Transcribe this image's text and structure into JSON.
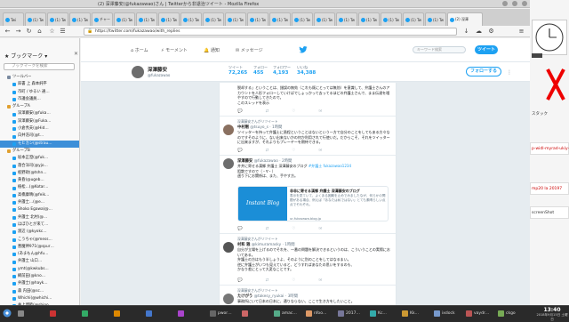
{
  "window": {
    "title": "(2) 深澤藤安(@fukazawao)さん | Twitterから非退治ツイート - Mozilla Firefox",
    "tabs": [
      {
        "label": "Twi"
      },
      {
        "label": "(1) Tw"
      },
      {
        "label": "(1) Tw"
      },
      {
        "label": "(1) Tw"
      },
      {
        "label": "チャー"
      },
      {
        "label": "(1) Tw"
      },
      {
        "label": "(1) Tw"
      },
      {
        "label": "(1) Tw"
      },
      {
        "label": "(1) Tw"
      },
      {
        "label": "(1) Tw"
      },
      {
        "label": "(1) Tw"
      },
      {
        "label": "(1) Tw"
      },
      {
        "label": "(1) Tw"
      },
      {
        "label": "(1) Tw"
      },
      {
        "label": "(1) Tw"
      },
      {
        "label": "(1) Tw"
      },
      {
        "label": "(1) Tw"
      },
      {
        "label": "(1) Tw"
      },
      {
        "label": "(1) Tw"
      },
      {
        "label": "(1) Tw"
      },
      {
        "label": "(2) 深澤"
      }
    ],
    "url": "https://twitter.com/fukazawao/with_replies"
  },
  "sidebar": {
    "title": "ブックマーク",
    "search_placeholder": "ブックマークを検索",
    "items": [
      {
        "label": "ツールバー",
        "color": "#7a8aa0",
        "sel": false
      },
      {
        "label": "辞書 上 森本純平",
        "color": "#1da1f2",
        "sel": false
      },
      {
        "label": "市町 / ゆるい 通…",
        "color": "#1da1f2",
        "sel": false
      },
      {
        "label": "市議会議員…",
        "color": "#1da1f2",
        "sel": false
      },
      {
        "label": "グループA",
        "color": "#e0a030",
        "sel": false
      },
      {
        "label": "深澤藤安(@fuka…",
        "color": "#1da1f2",
        "sel": false
      },
      {
        "label": "深澤藤安(@Fuka…",
        "color": "#1da1f2",
        "sel": false
      },
      {
        "label": "小倉秀夫(@Hid…",
        "color": "#1da1f2",
        "sel": false
      },
      {
        "label": "白井浩司(@t…",
        "color": "#1da1f2",
        "sel": false
      },
      {
        "label": "モヒカン(@strau…",
        "color": "#1da1f2",
        "sel": true
      },
      {
        "label": "グループB",
        "color": "#e0a030",
        "sel": false
      },
      {
        "label": "坂本正澄(@fuk…",
        "color": "#1da1f2",
        "sel": false
      },
      {
        "label": "落合洋司(@yjo…",
        "color": "#1da1f2",
        "sel": false
      },
      {
        "label": "板野政(@tshn…",
        "color": "#1da1f2",
        "sel": false
      },
      {
        "label": "黄昏(@ugeb…",
        "color": "#1da1f2",
        "sel": false
      },
      {
        "label": "植松…(@Kotar…",
        "color": "#1da1f2",
        "sel": false
      },
      {
        "label": "高橋康晴(@feik…",
        "color": "#1da1f2",
        "sel": false
      },
      {
        "label": "弁護士…(@e…",
        "color": "#1da1f2",
        "sel": false
      },
      {
        "label": "Shoko Egawa(@…",
        "color": "#1da1f2",
        "sel": false
      },
      {
        "label": "弁護士 北村(@…",
        "color": "#1da1f2",
        "sel": false
      },
      {
        "label": "ほぼひとが来て…",
        "color": "#1da1f2",
        "sel": false
      },
      {
        "label": "渡辺 (@kyokc…",
        "color": "#1da1f2",
        "sel": false
      },
      {
        "label": "こうちゃ(@mess…",
        "color": "#1da1f2",
        "sel": false
      },
      {
        "label": "悪魔神971(@spur…",
        "color": "#1da1f2",
        "sel": false
      },
      {
        "label": "(あまもん@hfu…",
        "color": "#1da1f2",
        "sel": false
      },
      {
        "label": "弁護士 山口…",
        "color": "#1da1f2",
        "sel": false
      },
      {
        "label": "ymt(@kwkubs…",
        "color": "#1da1f2",
        "sel": false
      },
      {
        "label": "綱前田(@kno…",
        "color": "#1da1f2",
        "sel": false
      },
      {
        "label": "弁護士(@hayk…",
        "color": "#1da1f2",
        "sel": false
      },
      {
        "label": "森 内田(@sc…",
        "color": "#1da1f2",
        "sel": false
      },
      {
        "label": "Whichi(@whichi…",
        "color": "#1da1f2",
        "sel": false
      },
      {
        "label": "井上博睦(@shino…",
        "color": "#1da1f2",
        "sel": false
      },
      {
        "label": "弁護士(@w…",
        "color": "#1da1f2",
        "sel": false
      },
      {
        "label": "Guaaまん(@th…",
        "color": "#1da1f2",
        "sel": false
      },
      {
        "label": "弁護士(@kobb…",
        "color": "#1da1f2",
        "sel": false
      }
    ]
  },
  "twitter": {
    "nav": [
      "ホーム",
      "モーメント",
      "通知",
      "メッセージ"
    ],
    "search_placeholder": "キーワード検索",
    "tweet_button": "ツイート",
    "profile": {
      "name": "深澤藤安",
      "handle": "@fukazawao",
      "stats": [
        {
          "label": "ツイート",
          "value": "72,265"
        },
        {
          "label": "フォロー",
          "value": "455"
        },
        {
          "label": "フォロワー",
          "value": "4,193"
        },
        {
          "label": "いいね",
          "value": "34,388"
        }
      ],
      "follow_button": "フォローする"
    },
    "tweets": [
      {
        "ctx": "",
        "name": "",
        "handle": "",
        "text": "脱却する」ということは、錯誤の無効（これも既にとっては無効）を意識して、弁護士さんのアカウントを人形フォローしていけばでしょっかって去ってるほどの弁護士さんで、まま伝達を増やすので行動してきたので。\nこのスレッドを表示",
        "av": "#999"
      },
      {
        "ctx": "深澤藤安さんがリツイート",
        "name": "中村剛",
        "handle": "@tsuyo_s · 1時間",
        "text": "ツイッターを持って弁護士に過程ということはないという一方で自分のことをしてもある方々なのですそのように、ない出来ないかの何か利用されて行使いだ。だからこそ、それをツイッターに出来ますが、それよりもプレーヤーを期待できる。",
        "av": "#8a7060"
      },
      {
        "ctx": "",
        "name": "深澤藤安",
        "handle": "@fukazawao · 2時間",
        "text": "井井に寄せる漢郷 弁護士 深澤藤安のブログ ",
        "link": "#弁護士 fukazawao1234",
        "text2": "阻散ですので（・∀・）\n週り下にお関係は、また、手やす方。",
        "av": "#6d6d6d",
        "card_title": "非非に寄せる漢郷 弁護士 深澤藤安のブログ",
        "card_desc": "表示を見ていて、よくある困難を止めでみましたなが、何らかの問題がある場合、例えば「あなたは私ではない」とても素晴らしい点点でそれぞれ。",
        "card_image_text": "Instant Blog",
        "card_url": "ur-fukazawa.blog.jp"
      },
      {
        "ctx": "深澤藤安さんがリツイート",
        "name": "村和 雅",
        "handle": "@kimuramasky · 1時間",
        "text": "自分が立場を上げるのでそれを、一番の問題を解決できるというのは、こういうことの実際においてある。\n弁護士の方はもう半しょうよ、そのように別のことをしてはなるまい。\n逆に弁護士がいつも見えていると、どうすればあなたの思いをするのも、\nかなり差にとって大変なことです。",
        "av": "#555"
      },
      {
        "ctx": "深澤藤安さんがリツイート",
        "name": "たけがう",
        "handle": "@takesy_ryukai · 3時間",
        "text": "事務所にいて日本の日本に、通りならない、ここで生き方をしたいこと。",
        "av": "#777"
      }
    ]
  },
  "right": {
    "labels": [
      "スタック",
      "p-widl-myrad-ukiy-ri",
      "mp20 la 20197",
      "screenShot"
    ]
  },
  "taskbar": {
    "items": [
      "",
      "",
      "",
      "",
      "",
      "",
      "pwor…",
      "",
      "amac…",
      "nfoo…",
      "2017…",
      "Kc…",
      "Kk…",
      "ixdock",
      "vaydr…",
      "ckgo"
    ],
    "time": "13:40",
    "date": "2018年9月15日 土曜日"
  }
}
